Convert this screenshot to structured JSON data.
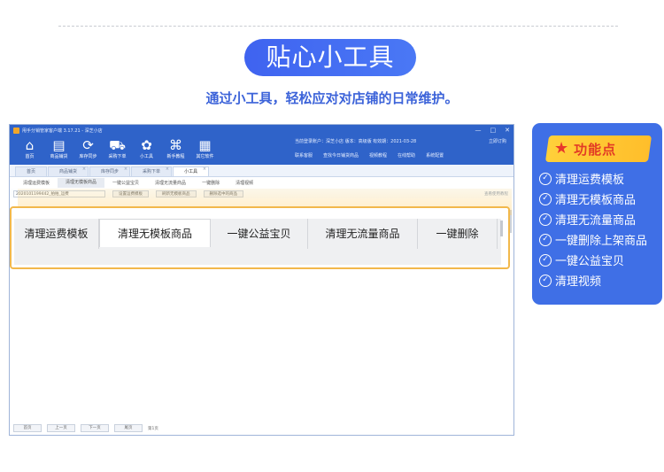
{
  "hero": {
    "title": "贴心小工具",
    "subtitle": "通过小工具，轻松应对对店铺的日常维护。"
  },
  "app": {
    "window_title": "甩手分销管家客户端 3.17.21 - 深芝小店",
    "window_controls": [
      "—",
      "□",
      "✕"
    ],
    "toolbar": [
      {
        "label": "首页",
        "icon": "home-icon",
        "glyph": "⌂"
      },
      {
        "label": "商品铺货",
        "icon": "store-icon",
        "glyph": "▤"
      },
      {
        "label": "库存同步",
        "icon": "sync-icon",
        "glyph": "⟳"
      },
      {
        "label": "采购下单",
        "icon": "cart-icon",
        "glyph": "⛟"
      },
      {
        "label": "小工具",
        "icon": "tools-icon",
        "glyph": "✿"
      },
      {
        "label": "新手教程",
        "icon": "tutorial-icon",
        "glyph": "⌘"
      },
      {
        "label": "其它软件",
        "icon": "apps-icon",
        "glyph": "▦"
      }
    ],
    "account_info": "当前登录账户：深芝小店   版本：高级版   有效期：2021-03-28",
    "account_button": "立即订购",
    "header_links": [
      "联系客服",
      "查找今日铺货商品",
      "视频教程",
      "在线帮助",
      "系统配置"
    ],
    "tabs": [
      {
        "label": "首页",
        "active": false
      },
      {
        "label": "商品铺货",
        "active": false
      },
      {
        "label": "库存同步",
        "active": false
      },
      {
        "label": "采购下单",
        "active": false
      },
      {
        "label": "小工具",
        "active": true
      }
    ],
    "sub_tabs": [
      {
        "label": "清理运费模板",
        "active": false
      },
      {
        "label": "清理无模板商品",
        "active": true
      },
      {
        "label": "一键公益宝贝",
        "active": false
      },
      {
        "label": "清理无流量商品",
        "active": false
      },
      {
        "label": "一键删除",
        "active": false
      },
      {
        "label": "清理视频",
        "active": false
      }
    ],
    "select_value": "2020101199442_拍拍_运费",
    "action_buttons": [
      "设置运费模板",
      "刷新无模板商品",
      "删除选中的商品"
    ],
    "right_link": "查看使用教程",
    "pager": {
      "buttons": [
        "首页",
        "上一页",
        "下一页",
        "尾页"
      ],
      "info": "第1页"
    }
  },
  "zoom_tabs": [
    {
      "label": "清理运费模板",
      "active": false
    },
    {
      "label": "清理无模板商品",
      "active": true
    },
    {
      "label": "一键公益宝贝",
      "active": false
    },
    {
      "label": "清理无流量商品",
      "active": false
    },
    {
      "label": "一键删除",
      "active": false
    }
  ],
  "features": {
    "title": "功能点",
    "items": [
      "清理运费模板",
      "清理无模板商品",
      "清理无流量商品",
      "一键删除上架商品",
      "一键公益宝贝",
      "清理视频"
    ]
  },
  "colors": {
    "brand_blue": "#3f6fe6",
    "app_blue": "#2f63c9",
    "highlight_orange": "#f2b84b",
    "badge_yellow": "#ffc83a"
  }
}
